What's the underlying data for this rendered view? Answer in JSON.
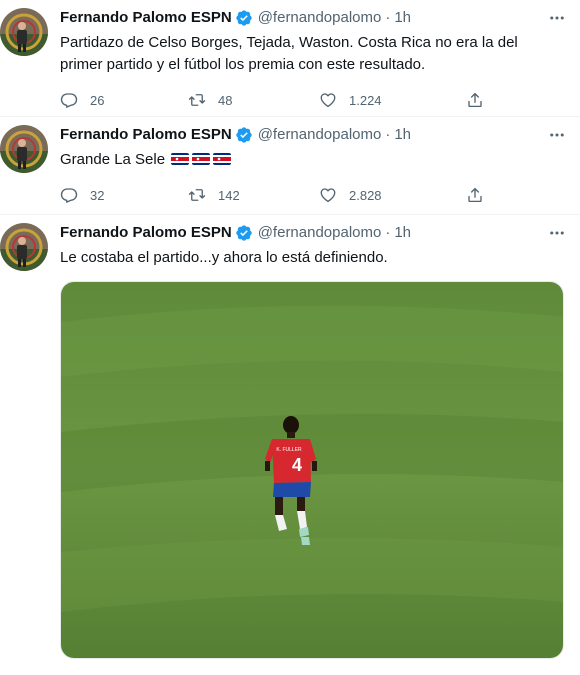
{
  "author": {
    "name": "Fernando Palomo ESPN",
    "handle": "@fernandopalomo",
    "separator": "·"
  },
  "icons": {
    "verified": "verified-badge-icon",
    "more": "more-horizontal-icon",
    "reply": "reply-icon",
    "retweet": "retweet-icon",
    "like": "heart-icon",
    "share": "share-icon"
  },
  "colors": {
    "verified": "#1d9bf0",
    "secondary_text": "#536471",
    "text": "#0f1419",
    "divider": "#eff3f4",
    "cr_blue": "#002b7f",
    "cr_red": "#ce1126"
  },
  "tweets": [
    {
      "time": "1h",
      "text": "Partidazo de Celso Borges, Tejada, Waston. Costa Rica no era la del primer partido y el fútbol los premia con este resultado.",
      "replies": "26",
      "retweets": "48",
      "likes": "1.224"
    },
    {
      "time": "1h",
      "text": "Grande La Sele",
      "flags": [
        "costa-rica-flag",
        "costa-rica-flag",
        "costa-rica-flag"
      ],
      "replies": "32",
      "retweets": "142",
      "likes": "2.828"
    },
    {
      "time": "1h",
      "text": "Le costaba el partido...y ahora lo está definiendo.",
      "media": {
        "description": "Costa Rica player number 4 jogging on a grass football pitch",
        "jersey_name": "K. FULLER",
        "jersey_number": "4"
      }
    }
  ]
}
